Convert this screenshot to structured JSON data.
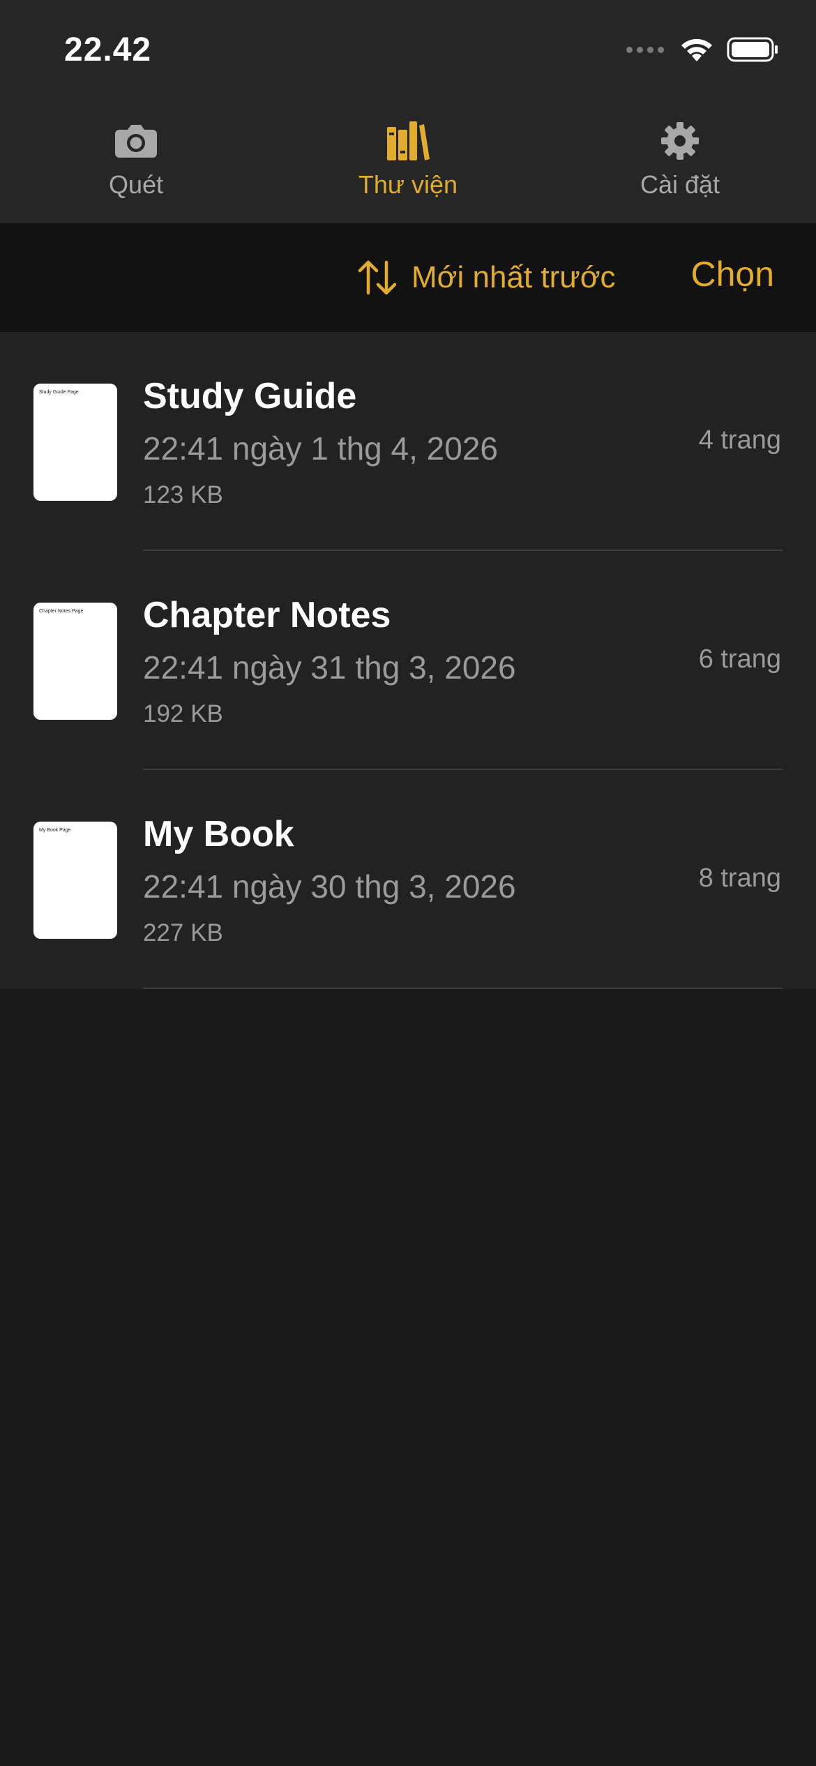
{
  "status_bar": {
    "time": "22.42"
  },
  "tabs": [
    {
      "label": "Quét",
      "icon": "camera-icon",
      "active": false
    },
    {
      "label": "Thư viện",
      "icon": "books-icon",
      "active": true
    },
    {
      "label": "Cài đặt",
      "icon": "gear-icon",
      "active": false
    }
  ],
  "toolbar": {
    "sort_label": "Mới nhất trước",
    "sort_icon": "sort-arrows-icon",
    "select_label": "Chọn"
  },
  "documents": [
    {
      "title": "Study Guide",
      "date": "22:41 ngày 1 thg 4, 2026",
      "size": "123 KB",
      "pages": "4 trang",
      "thumb_text": "Study Guide Page"
    },
    {
      "title": "Chapter Notes",
      "date": "22:41 ngày 31 thg 3, 2026",
      "size": "192 KB",
      "pages": "6 trang",
      "thumb_text": "Chapter Notes Page"
    },
    {
      "title": "My Book",
      "date": "22:41 ngày 30 thg 3, 2026",
      "size": "227 KB",
      "pages": "8 trang",
      "thumb_text": "My Book Page"
    }
  ],
  "colors": {
    "accent": "#e2ac2f",
    "background": "#1a1a1a",
    "bar_background": "#262626",
    "toolbar_background": "#121212",
    "list_background": "#222222"
  }
}
